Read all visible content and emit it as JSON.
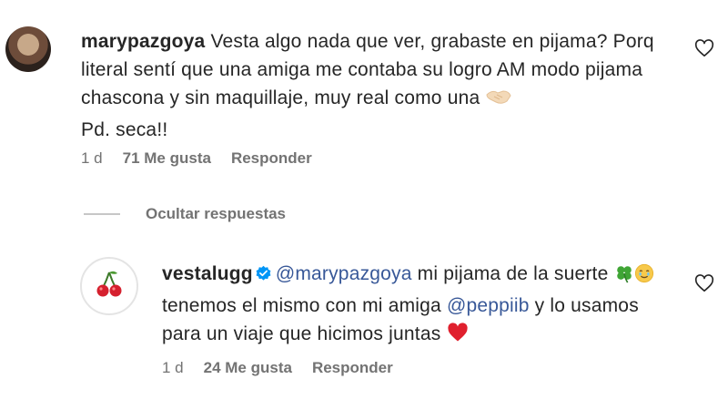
{
  "comment1": {
    "username": "marypazgoya",
    "text_line1": " Vesta algo nada que ver, grabaste en pijama? Porq literal sentí que una amiga me contaba su logro AM modo pijama chascona y sin maquillaje, muy real como una ",
    "text_line2": "Pd. seca!!",
    "time": "1 d",
    "likes": "71 Me gusta",
    "reply": "Responder",
    "emoji_icon": "handshake-icon"
  },
  "hide_replies": "Ocultar respuestas",
  "reply1": {
    "username": "vestalugg",
    "mention": "@marypazgoya",
    "text_part1": " mi pijama de la suerte ",
    "text_part2": " tenemos el mismo con mi amiga ",
    "mention2": "@peppiib",
    "text_part3": " y lo usamos para un viaje que hicimos juntas ",
    "time": "1 d",
    "likes": "24 Me gusta",
    "reply": "Responder",
    "avatar_icon": "cherries-icon"
  },
  "colors": {
    "text": "#262626",
    "meta": "#737373",
    "mention": "#385898",
    "verified": "#0095f6",
    "heart_red": "#e0245e"
  }
}
